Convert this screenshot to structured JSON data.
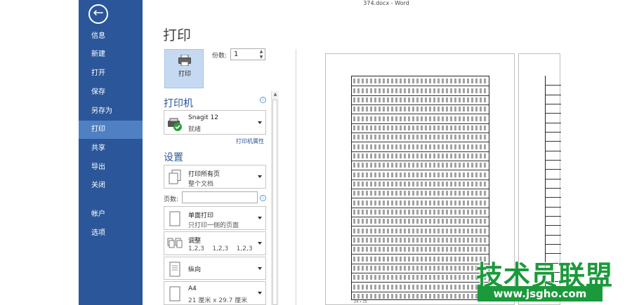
{
  "window": {
    "title": "374.docx - Word"
  },
  "sidebar": {
    "back_icon": "←",
    "items": [
      {
        "label": "信息"
      },
      {
        "label": "新建"
      },
      {
        "label": "打开"
      },
      {
        "label": "保存"
      },
      {
        "label": "另存为"
      },
      {
        "label": "打印",
        "active": true
      },
      {
        "label": "共享"
      },
      {
        "label": "导出"
      },
      {
        "label": "关闭"
      },
      {
        "label": "帐户"
      },
      {
        "label": "选项"
      }
    ]
  },
  "print": {
    "title": "打印",
    "button_label": "打印",
    "copies_label": "份数:",
    "copies_value": "1"
  },
  "printer": {
    "heading": "打印机",
    "name": "Snagit 12",
    "status": "就绪",
    "properties_link": "打印机属性"
  },
  "settings": {
    "heading": "设置",
    "range_title": "打印所有页",
    "range_sub": "整个文档",
    "pages_label": "页数:",
    "sides_title": "单面打印",
    "sides_sub": "只打印一侧的页面",
    "collate_title": "调整",
    "collate_sub": "1,2,3    1,2,3    1,2,3",
    "orientation_title": "纵向",
    "paper_title": "A4",
    "paper_sub": "21 厘米 x 29.7 厘米"
  },
  "preview": {
    "page_number": "24 • 25"
  },
  "watermark": {
    "main": "技术员联盟",
    "url": "www.jsgho.com"
  },
  "colors": {
    "sidebar": "#2b579a",
    "sidebar_active": "#5080c4",
    "accent": "#2b579a",
    "print_button": "#c5d9f1",
    "watermark": "#1a9a3a"
  }
}
